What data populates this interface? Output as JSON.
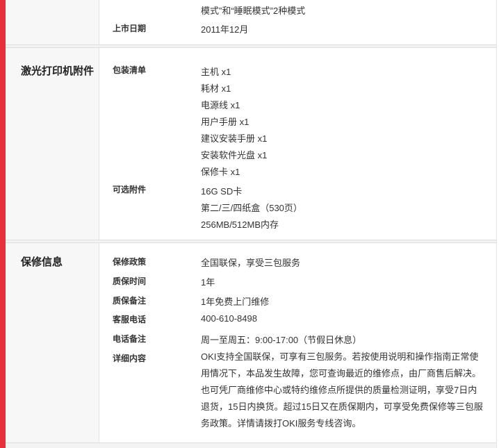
{
  "top": {
    "partial_line": "模式”和“睡眠模式”2种模式",
    "release_label": "上市日期",
    "release_value": "2011年12月"
  },
  "accessories": {
    "title": "激光打印机附件",
    "package_label": "包装清单",
    "package_items": [
      "主机 x1",
      "耗材 x1",
      "电源线 x1",
      "用户手册 x1",
      "建议安装手册 x1",
      "安装软件光盘 x1",
      "保修卡 x1"
    ],
    "optional_label": "可选附件",
    "optional_items": [
      "16G SD卡",
      "第二/三/四纸盒（530页）",
      "256MB/512MB内存"
    ]
  },
  "warranty": {
    "title": "保修信息",
    "policy_label": "保修政策",
    "policy_value": "全国联保，享受三包服务",
    "period_label": "质保时间",
    "period_value": "1年",
    "note_label": "质保备注",
    "note_value": "1年免费上门维修",
    "phone_label": "客服电话",
    "phone_value": "400-610-8498",
    "phone_note_label": "电话备注",
    "phone_note_value": "周一至周五：9:00-17:00（节假日休息）",
    "detail_label": "详细内容",
    "detail_lines": [
      "OKI支持全国联保，可享有三包服务。若按使用说明和操作指南正常使",
      "用情况下，本品发生故障，您可查询最近的维修点，由厂商售后解决。",
      "也可凭厂商维修中心或特约维修点所提供的质量检测证明，享受7日内",
      "退货，15日内换货。超过15日又在质保期内，可享受免费保修等三包服",
      "务政策。详情请拨打OKI服务专线咨询。"
    ]
  }
}
